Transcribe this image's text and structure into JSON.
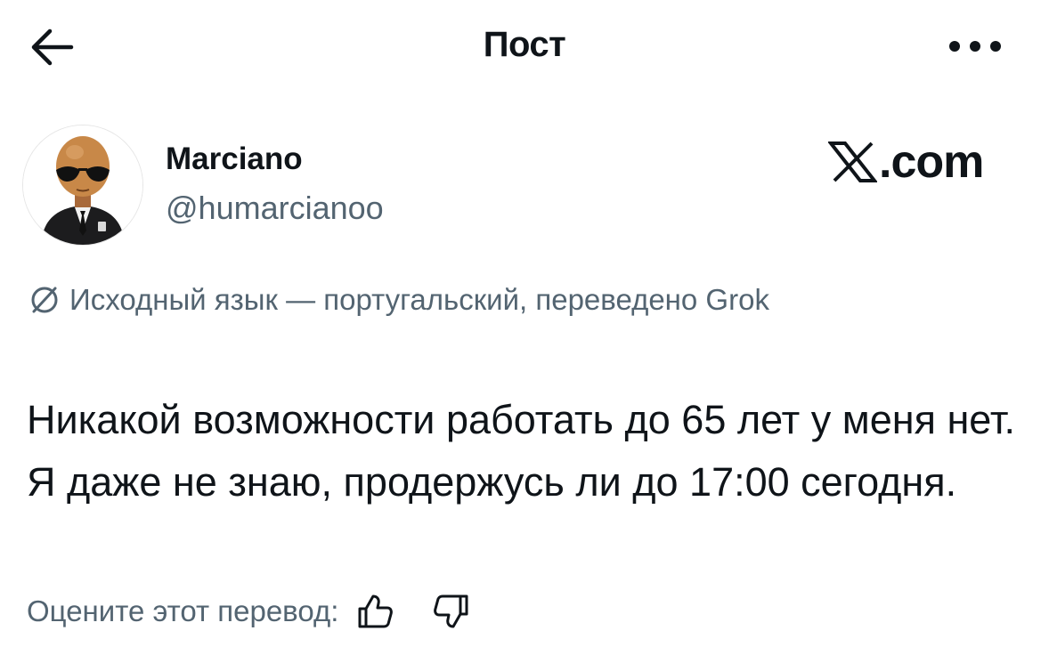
{
  "header": {
    "title": "Пост",
    "back_icon": "arrow-left-icon",
    "more_icon": "more-horizontal-icon"
  },
  "author": {
    "name": "Marciano",
    "handle": "@humarcianoo",
    "avatar": "alien-in-suit-avatar"
  },
  "brand": {
    "icon": "x-logo-icon",
    "text": ".com"
  },
  "translation": {
    "icon": "translate-icon",
    "note": "Исходный язык — португальский, переведено Grok"
  },
  "post": {
    "text": "Никакой возможности работать до 65 лет у меня нет. Я даже не знаю, продержусь ли до 17:00 сегодня."
  },
  "rating": {
    "prompt": "Оцените этот перевод:",
    "up_icon": "thumbs-up-icon",
    "down_icon": "thumbs-down-icon"
  },
  "colors": {
    "text": "#0f1419",
    "secondary": "#536471",
    "background": "#ffffff"
  }
}
